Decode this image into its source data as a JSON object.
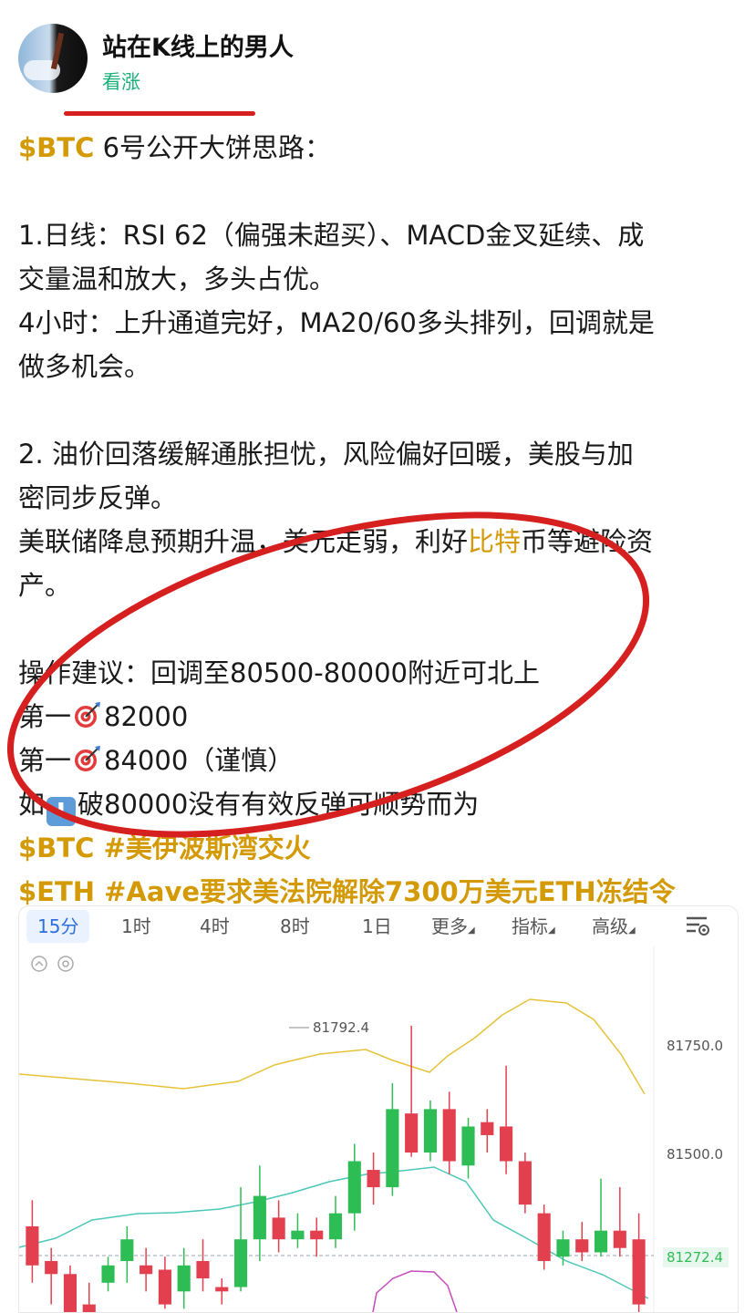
{
  "author": {
    "name": "站在K线上的男人",
    "sentiment": "看涨"
  },
  "post": {
    "l1_tag": "$BTC",
    "l1_text": " 6号公开大饼思路：",
    "l2": "1.日线：RSI 62（偏强未超买）、MACD金叉延续、成",
    "l3": "交量温和放大，多头占优。",
    "l4": "4小时：上升通道完好，MA20/60多头排列，回调就是",
    "l5": "做多机会。",
    "l6": "2. 油价回落缓解通胀担忧，风险偏好回暖，美股与加",
    "l7": "密同步反弹。",
    "l8a": "美联储降息预期升温，美元走弱，利好",
    "l8b": "比特",
    "l8c": "币等避险资",
    "l9": "产。",
    "l10": "操作建议：回调至80500-80000附近可北上",
    "l11a": "第一",
    "l11b": "82000",
    "l12a": "第一",
    "l12b": "84000（谨慎）",
    "l13a": "如",
    "l13b": "破80000没有有效反弹可顺势而为",
    "tag1": "$BTC #美伊波斯湾交火",
    "tag2": "$ETH #Aave要求美法院解除7300万美元ETH冻结令",
    "icons": [
      "target-emoji",
      "down-arrow-emoji"
    ]
  },
  "chart": {
    "tabs": [
      "15分",
      "1时",
      "4时",
      "8时",
      "1日",
      "更多",
      "指标",
      "高级"
    ],
    "active_tab": "15分",
    "price_labels": [
      "81750.0",
      "81500.0"
    ],
    "current_price": "81272.4",
    "high_label": "81792.4",
    "colors": {
      "up": "#2ebd55",
      "down": "#e2404f",
      "upper_band": "#e6c23a",
      "ma": "#4cc8b8",
      "purple": "#c74bbf",
      "accent": "#2d6fe0"
    }
  },
  "chart_data": {
    "type": "candlestick",
    "ylim": [
      81150,
      81850
    ],
    "y_ticks": [
      81750.0,
      81500.0
    ],
    "current": 81272.4,
    "high_annotation": 81792.4,
    "candles": [
      {
        "o": 81330,
        "c": 81240,
        "h": 81390,
        "l": 81200
      },
      {
        "o": 81250,
        "c": 81220,
        "h": 81280,
        "l": 81150
      },
      {
        "o": 81220,
        "c": 81100,
        "h": 81240,
        "l": 81050
      },
      {
        "o": 81150,
        "c": 81120,
        "h": 81200,
        "l": 81080
      },
      {
        "o": 81200,
        "c": 81240,
        "h": 81260,
        "l": 81180
      },
      {
        "o": 81250,
        "c": 81300,
        "h": 81330,
        "l": 81200
      },
      {
        "o": 81240,
        "c": 81220,
        "h": 81280,
        "l": 81180
      },
      {
        "o": 81230,
        "c": 81150,
        "h": 81260,
        "l": 81140
      },
      {
        "o": 81180,
        "c": 81240,
        "h": 81280,
        "l": 81140
      },
      {
        "o": 81250,
        "c": 81210,
        "h": 81300,
        "l": 81180
      },
      {
        "o": 81190,
        "c": 81180,
        "h": 81210,
        "l": 81150
      },
      {
        "o": 81190,
        "c": 81300,
        "h": 81420,
        "l": 81180
      },
      {
        "o": 81300,
        "c": 81400,
        "h": 81470,
        "l": 81250
      },
      {
        "o": 81350,
        "c": 81300,
        "h": 81390,
        "l": 81270
      },
      {
        "o": 81300,
        "c": 81320,
        "h": 81360,
        "l": 81280
      },
      {
        "o": 81320,
        "c": 81300,
        "h": 81350,
        "l": 81260
      },
      {
        "o": 81300,
        "c": 81360,
        "h": 81400,
        "l": 81280
      },
      {
        "o": 81360,
        "c": 81480,
        "h": 81520,
        "l": 81320
      },
      {
        "o": 81460,
        "c": 81420,
        "h": 81500,
        "l": 81380
      },
      {
        "o": 81420,
        "c": 81600,
        "h": 81660,
        "l": 81400
      },
      {
        "o": 81590,
        "c": 81500,
        "h": 81792,
        "l": 81490
      },
      {
        "o": 81500,
        "c": 81600,
        "h": 81620,
        "l": 81480
      },
      {
        "o": 81600,
        "c": 81480,
        "h": 81640,
        "l": 81450
      },
      {
        "o": 81470,
        "c": 81560,
        "h": 81580,
        "l": 81440
      },
      {
        "o": 81570,
        "c": 81540,
        "h": 81600,
        "l": 81500
      },
      {
        "o": 81560,
        "c": 81480,
        "h": 81700,
        "l": 81450
      },
      {
        "o": 81480,
        "c": 81380,
        "h": 81500,
        "l": 81360
      },
      {
        "o": 81360,
        "c": 81250,
        "h": 81380,
        "l": 81230
      },
      {
        "o": 81260,
        "c": 81300,
        "h": 81320,
        "l": 81240
      },
      {
        "o": 81300,
        "c": 81270,
        "h": 81340,
        "l": 81250
      },
      {
        "o": 81270,
        "c": 81320,
        "h": 81440,
        "l": 81260
      },
      {
        "o": 81320,
        "c": 81280,
        "h": 81420,
        "l": 81260
      },
      {
        "o": 81300,
        "c": 81150,
        "h": 81360,
        "l": 81100
      }
    ]
  }
}
